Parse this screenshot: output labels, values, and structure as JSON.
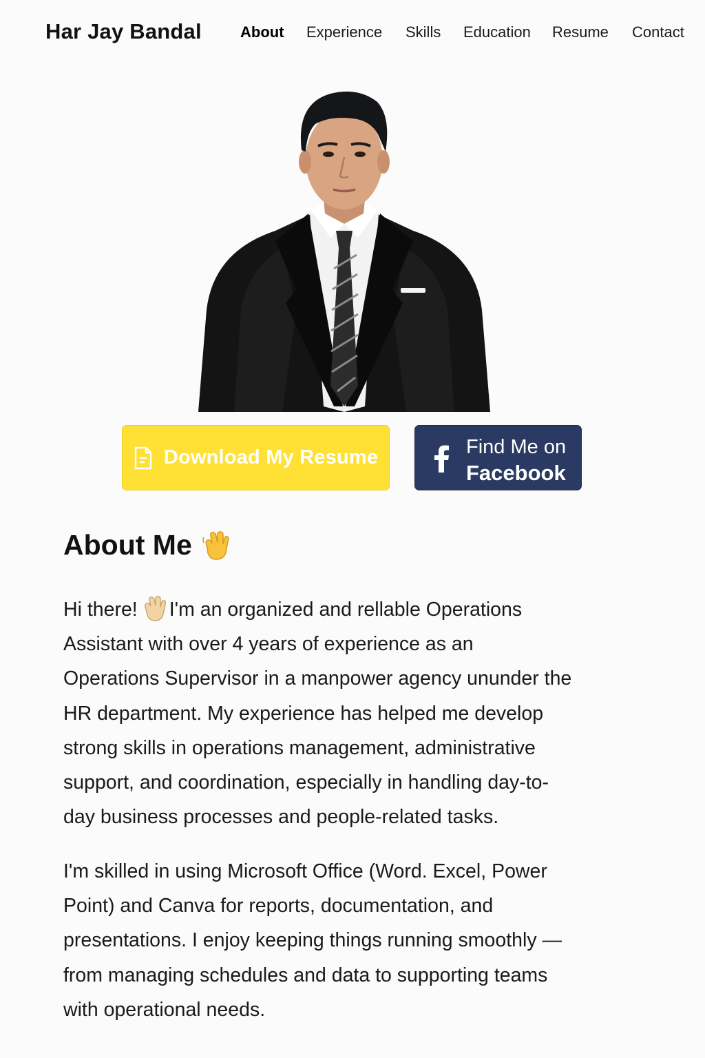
{
  "header": {
    "brand": "Har Jay Bandal",
    "nav": [
      {
        "label": "About",
        "active": true
      },
      {
        "label": "Experience",
        "active": false
      },
      {
        "label": "Skills",
        "active": false
      },
      {
        "label": "Education",
        "active": false
      },
      {
        "label": "Resume",
        "active": false
      },
      {
        "label": "Contact",
        "active": false
      }
    ]
  },
  "hero": {
    "photo_icon": "profile-photo",
    "resume_button": {
      "label": "Download My Resume",
      "icon": "document-icon",
      "color": "#ffe035"
    },
    "facebook_button": {
      "line1": "Find Me on",
      "line2": "Facebook",
      "icon": "facebook-icon",
      "color": "#2b3a62"
    }
  },
  "about": {
    "heading": "About Me",
    "heading_icon": "waving-hand-icon",
    "paragraph1_lines": [
      "Hi there!",
      "I'm an organized and rellable Operations",
      "Assistant with over 4 years of experience as an",
      "Operations Supervisor in a manpower agency ununder the",
      "HR department. My experience has helped me develop",
      "strong skills in operations management, administrative",
      "support, and coordination, especially in handling day-to-",
      "day business processes and people-related tasks."
    ],
    "paragraph2_lines": [
      "I'm skilled in using Microsoft Office (Word. Excel, Power",
      "Point) and Canva for reports, documentation, and",
      "presentations. I enjoy keeping things running smoothly —",
      "from managing schedules and data to supporting teams",
      "with operational needs."
    ]
  }
}
